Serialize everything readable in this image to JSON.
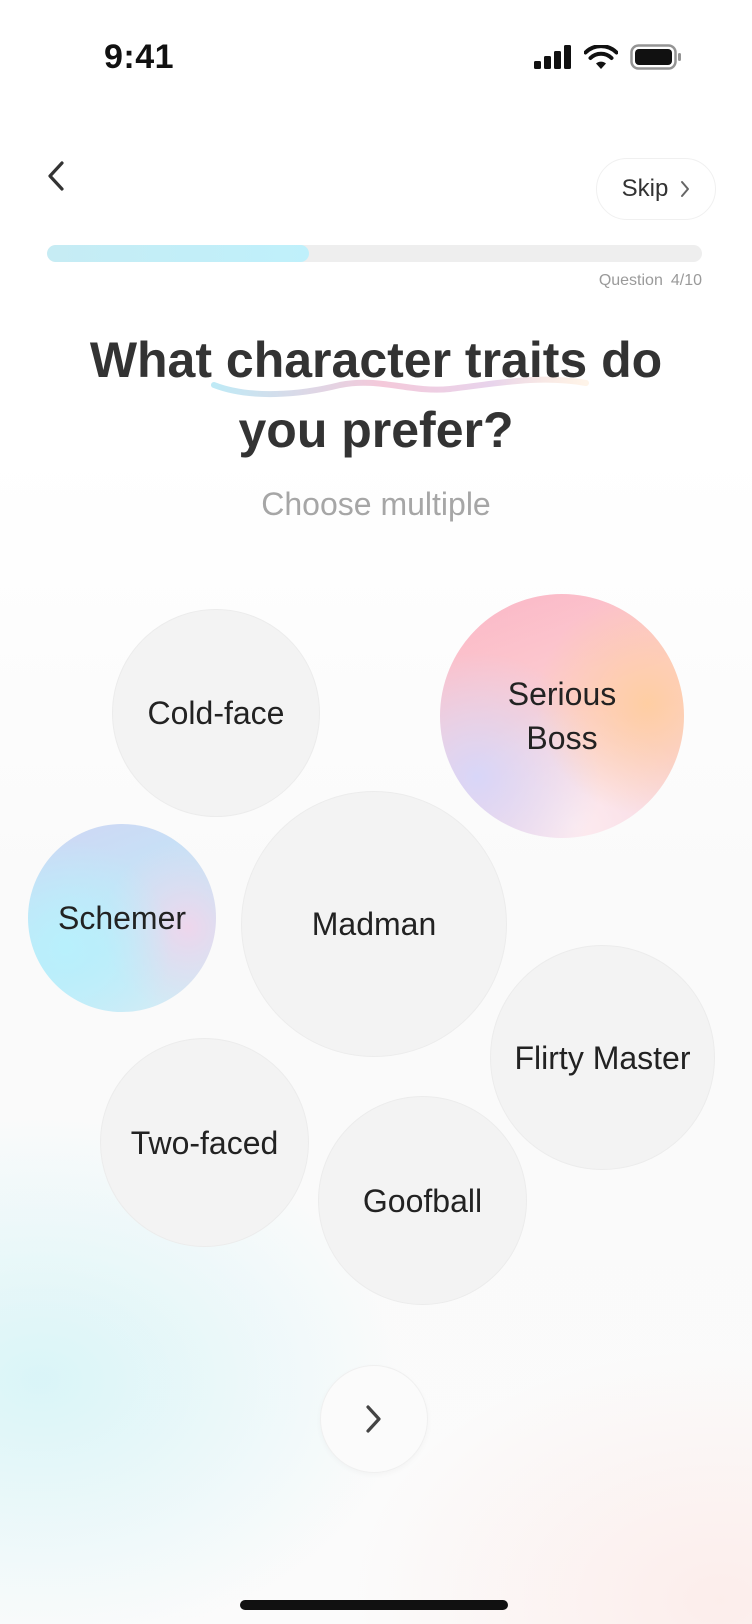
{
  "status_bar": {
    "time": "9:41",
    "icons": [
      "cellular-signal-icon",
      "wifi-icon",
      "battery-icon"
    ]
  },
  "header": {
    "back_icon": "chevron-left-icon",
    "skip_label": "Skip",
    "skip_icon": "chevron-right-icon"
  },
  "progress": {
    "value": 0.4,
    "label": "Question",
    "count": "4/10",
    "fill_color": "#bff0fb"
  },
  "question": {
    "title": "What character traits do you prefer?",
    "subtitle": "Choose multiple"
  },
  "options": [
    {
      "label": "Cold-face",
      "selected": false
    },
    {
      "label": "Serious Boss",
      "selected": true
    },
    {
      "label": "Schemer",
      "selected": true
    },
    {
      "label": "Madman",
      "selected": false
    },
    {
      "label": "Flirty Master",
      "selected": false
    },
    {
      "label": "Two-faced",
      "selected": false
    },
    {
      "label": "Goofball",
      "selected": false
    }
  ],
  "next_button": {
    "icon": "chevron-right-icon"
  },
  "colors": {
    "selected_pink": "#fbb6c6",
    "selected_blue": "#c0eaf8",
    "unselected": "#f3f3f3"
  }
}
